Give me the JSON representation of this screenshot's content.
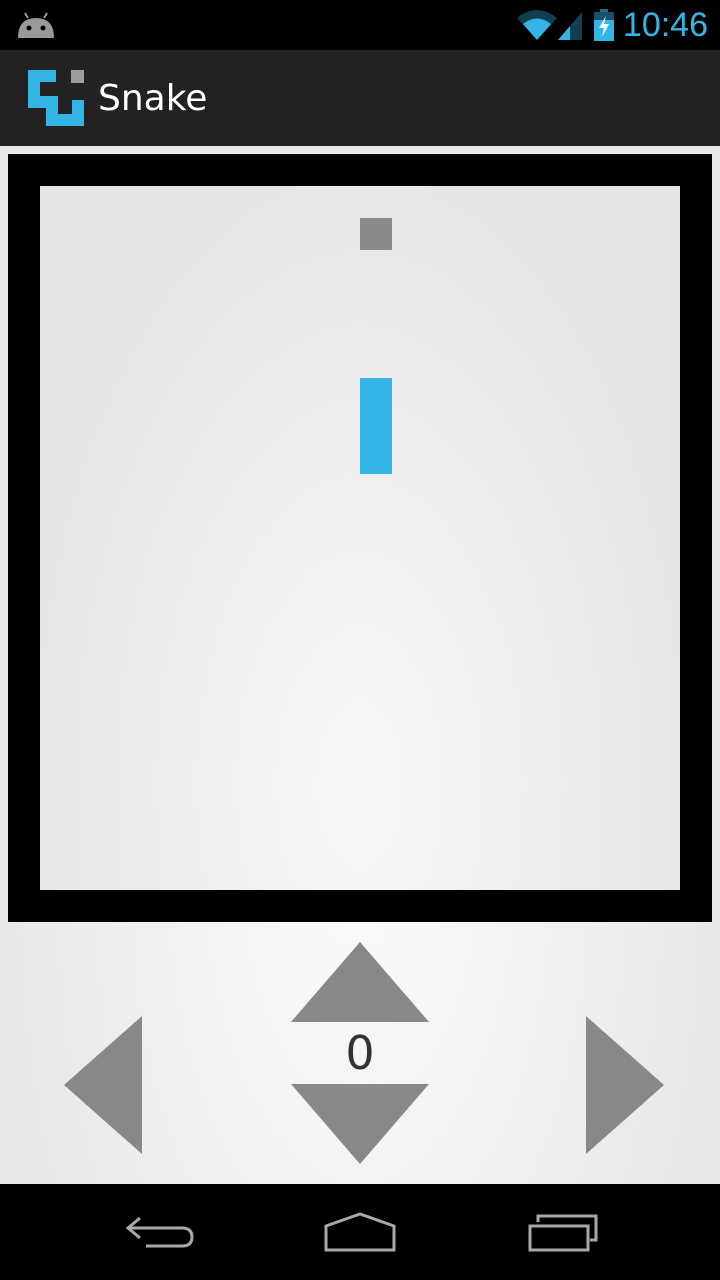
{
  "status_bar": {
    "time": "10:46",
    "icons": [
      "android-notification-icon",
      "wifi-icon",
      "signal-icon",
      "battery-charging-icon"
    ]
  },
  "action_bar": {
    "title": "Snake",
    "logo_icon": "snake-app-icon"
  },
  "game": {
    "score": "0",
    "grid": {
      "columns": 20,
      "rows": 22
    },
    "food": {
      "col": 10,
      "row": 1
    },
    "snake": [
      {
        "col": 10,
        "row": 6
      },
      {
        "col": 10,
        "row": 7
      },
      {
        "col": 10,
        "row": 8
      }
    ],
    "colors": {
      "snake": "#33b5e5",
      "food": "#8a8a8a",
      "frame": "#000000",
      "controls": "#888888"
    }
  },
  "controls": {
    "up": "arrow-up-icon",
    "down": "arrow-down-icon",
    "left": "arrow-left-icon",
    "right": "arrow-right-icon"
  },
  "nav_bar": {
    "buttons": [
      "back-icon",
      "home-icon",
      "recent-apps-icon"
    ]
  }
}
